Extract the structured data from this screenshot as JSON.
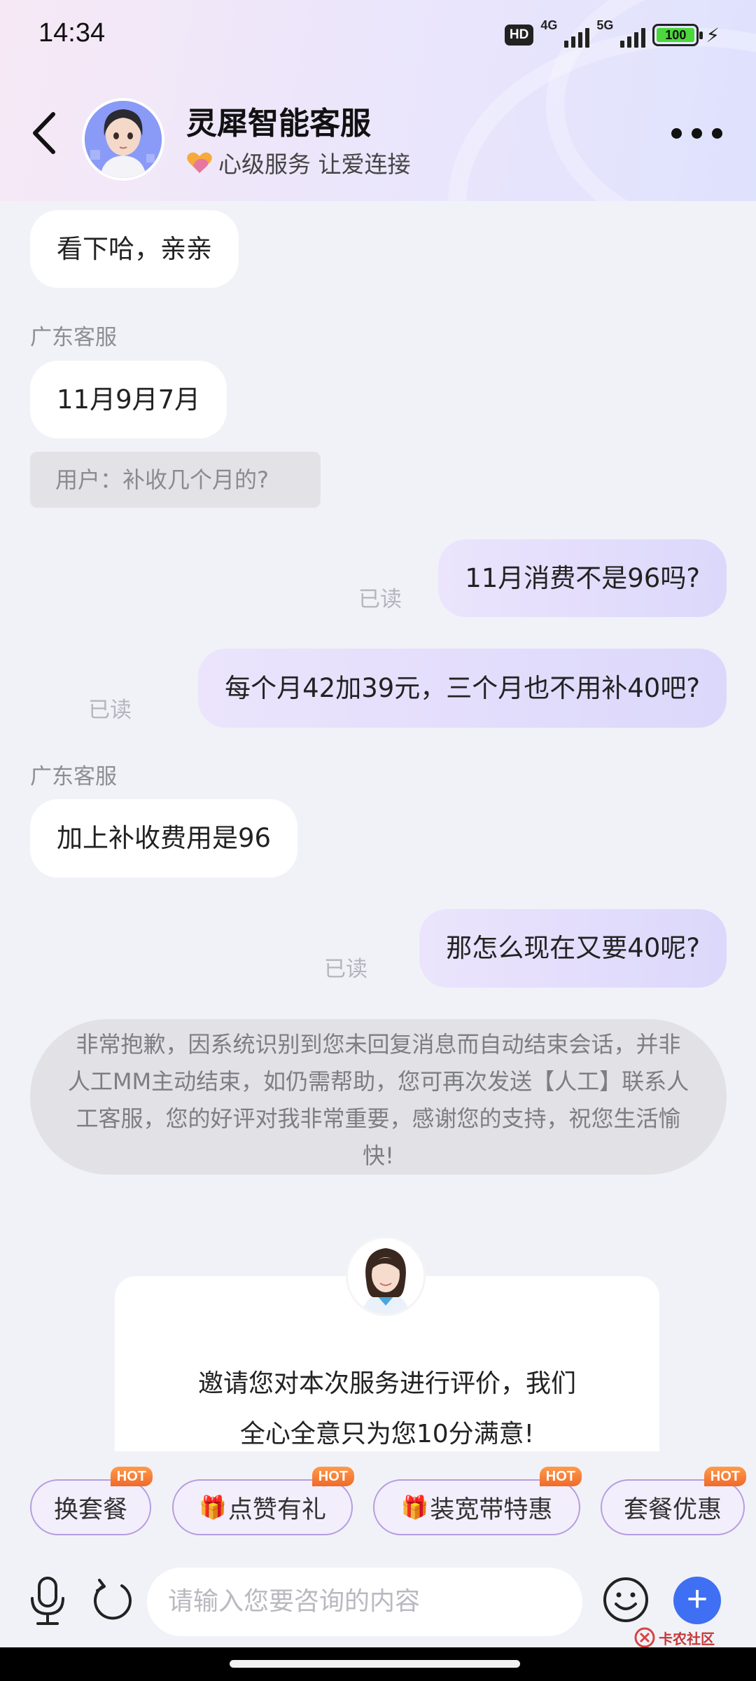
{
  "status_bar": {
    "time": "14:34",
    "hd_label": "HD",
    "network1": "4G",
    "network2": "5G",
    "battery": "100"
  },
  "header": {
    "title": "灵犀智能客服",
    "subtitle": "心级服务 让爱连接",
    "back_icon": "chevron-left-icon",
    "more_icon": "more-dots-icon"
  },
  "messages": [
    {
      "type": "in",
      "text": "看下哈，亲亲"
    },
    {
      "type": "sender",
      "text": "广东客服"
    },
    {
      "type": "in",
      "text": "11月9月7月"
    },
    {
      "type": "quote",
      "text": "用户：补收几个月的?"
    },
    {
      "type": "out",
      "text": "11月消费不是96吗?",
      "status": "已读"
    },
    {
      "type": "out",
      "text": "每个月42加39元，三个月也不用补40吧?",
      "status": "已读"
    },
    {
      "type": "sender",
      "text": "广东客服"
    },
    {
      "type": "in",
      "text": "加上补收费用是96"
    },
    {
      "type": "out",
      "text": "那怎么现在又要40呢?",
      "status": "已读"
    }
  ],
  "system_message": "非常抱歉，因系统识别到您未回复消息而自动结束会话，并非人工MM主动结束，如仍需帮助，您可再次发送【人工】联系人工客服，您的好评对我非常重要，感谢您的支持，祝您生活愉快!",
  "rating": {
    "line1": "邀请您对本次服务进行评价，我们",
    "line2": "全心全意只为您10分满意!"
  },
  "quick_chips": [
    {
      "label": "换套餐",
      "badge": "HOT",
      "gift": false
    },
    {
      "label": "点赞有礼",
      "badge": "HOT",
      "gift": true
    },
    {
      "label": "装宽带特惠",
      "badge": "HOT",
      "gift": true
    },
    {
      "label": "套餐优惠",
      "badge": "HOT",
      "gift": false
    }
  ],
  "input": {
    "placeholder": "请输入您要咨询的内容"
  },
  "watermark": {
    "text": "卡农社区"
  },
  "colors": {
    "accent": "#3f6ff3",
    "out_bubble": "#dcd8fb",
    "in_bubble": "#ffffff",
    "chip_border": "#b59ce0",
    "hot_badge": "#f06a2a"
  }
}
